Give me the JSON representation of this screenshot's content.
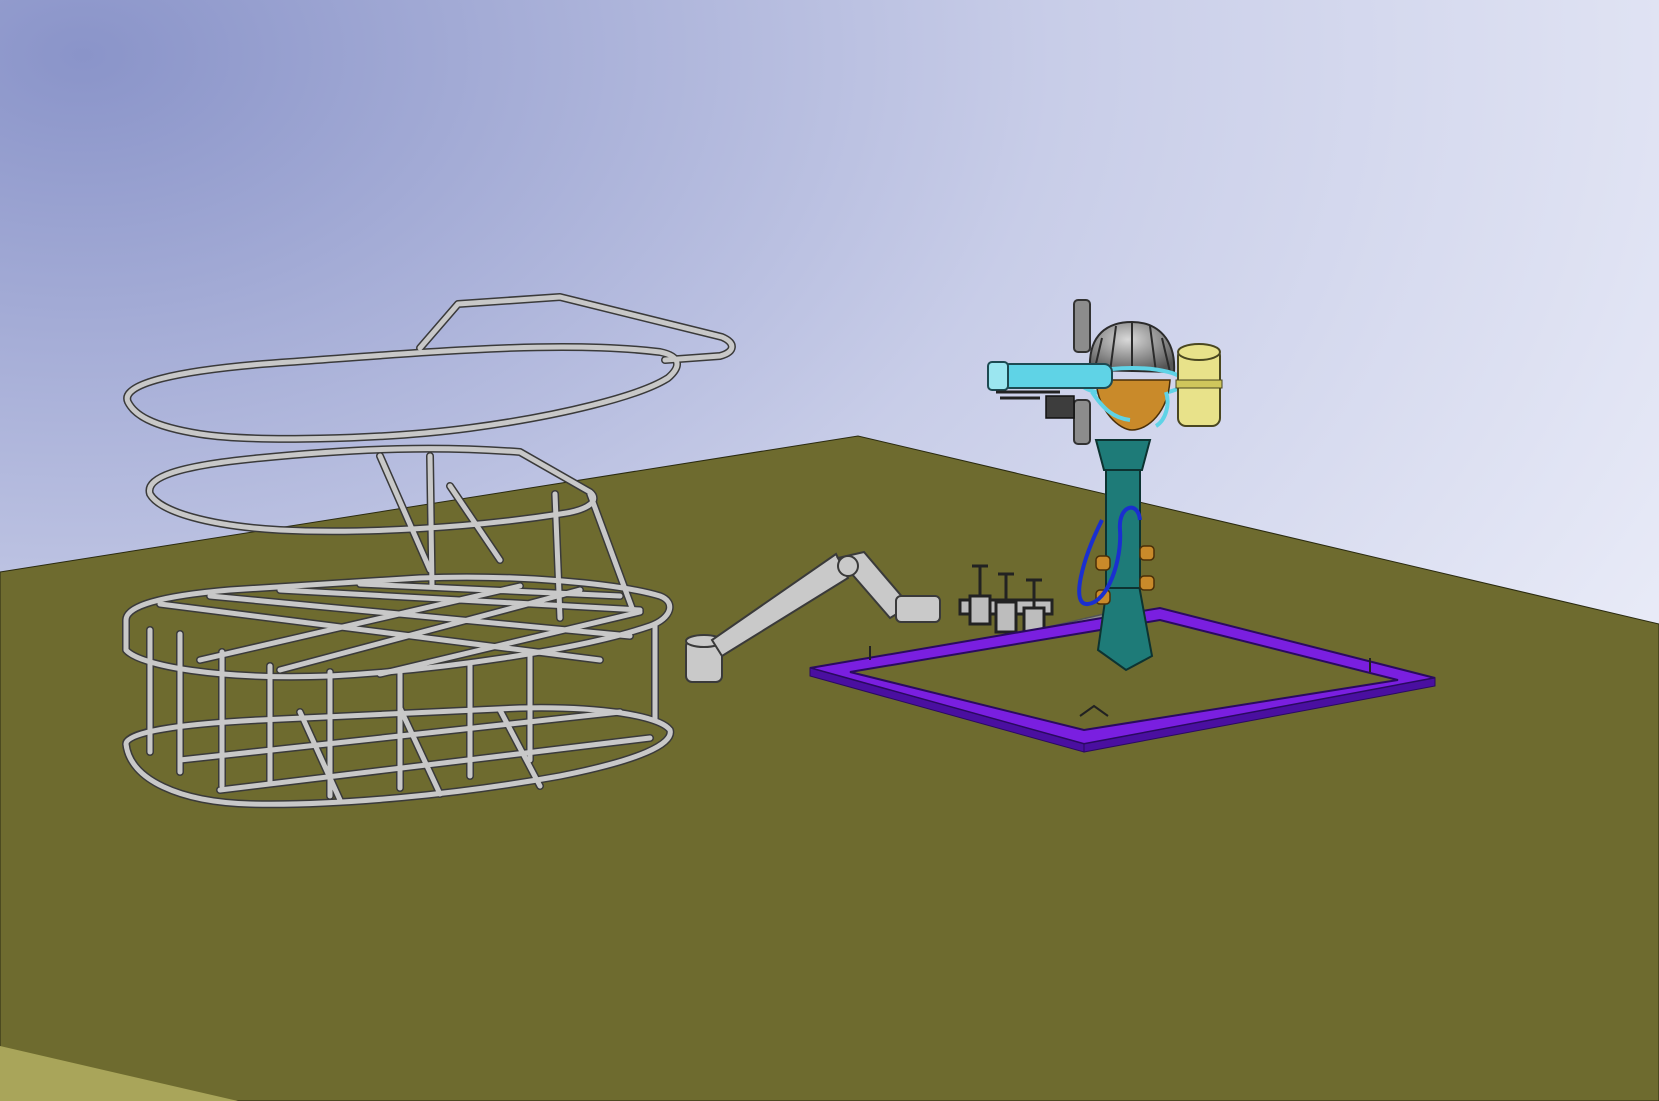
{
  "viewport": {
    "background": {
      "top": "#8a94c9",
      "mid": "#c8cde8",
      "bottom": "#eef0fa"
    },
    "floor_color": "#6e6b2f",
    "floor_edge_color": "#a9a55a"
  },
  "models": [
    {
      "name": "tubular-frame-cage",
      "color": "#c8c8c8",
      "edge_color": "#3a3a3a"
    },
    {
      "name": "robotic-arm",
      "color": "#c9c9c9",
      "edge_color": "#3a3a3a"
    },
    {
      "name": "tool-rack",
      "color": "#bdbdbd",
      "edge_color": "#222222"
    },
    {
      "name": "mount-base-frame",
      "color": "#7a1fe0",
      "edge_color": "#2a0a60"
    },
    {
      "name": "pedestal-column",
      "color": "#1e7b78",
      "edge_color": "#0d3331"
    },
    {
      "name": "sensor-head",
      "colors": [
        "#8c8c8c",
        "#5fd3e6",
        "#e8e28a",
        "#c98a2a"
      ]
    }
  ]
}
